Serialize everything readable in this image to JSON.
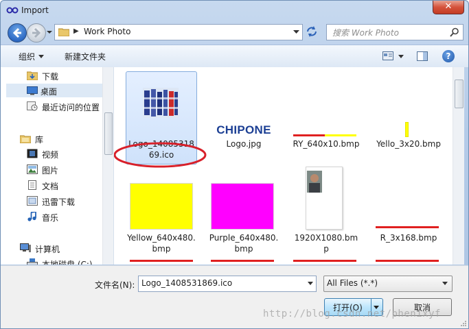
{
  "window": {
    "title": "Import",
    "close_label": "✕"
  },
  "nav": {
    "address_path": "Work Photo",
    "search_placeholder": "搜索 Work Photo"
  },
  "toolbar": {
    "organize_label": "组织",
    "new_folder_label": "新建文件夹",
    "help_label": "?"
  },
  "sidebar": {
    "items": [
      {
        "label": "下载",
        "icon": "download-folder-icon"
      },
      {
        "label": "桌面",
        "icon": "desktop-icon",
        "selected": true
      },
      {
        "label": "最近访问的位置",
        "icon": "recent-places-icon"
      },
      {
        "label": "库",
        "icon": "library-icon"
      },
      {
        "label": "视频",
        "icon": "video-library-icon"
      },
      {
        "label": "图片",
        "icon": "pictures-library-icon"
      },
      {
        "label": "文档",
        "icon": "documents-library-icon"
      },
      {
        "label": "迅雷下载",
        "icon": "thunder-download-icon"
      },
      {
        "label": "音乐",
        "icon": "music-library-icon"
      },
      {
        "label": "计算机",
        "icon": "computer-icon"
      },
      {
        "label": "本地磁盘 (C:)",
        "icon": "local-disk-icon"
      }
    ]
  },
  "files": {
    "items": [
      {
        "name_line1": "Logo_14085318",
        "name_line2": "69.ico",
        "selected": true
      },
      {
        "name_line1": "Logo.jpg",
        "name_line2": ""
      },
      {
        "name_line1": "RY_640x10.bmp",
        "name_line2": ""
      },
      {
        "name_line1": "Yello_3x20.bmp",
        "name_line2": ""
      },
      {
        "name_line1": "Yellow_640x480.",
        "name_line2": "bmp"
      },
      {
        "name_line1": "Purple_640x480.",
        "name_line2": "bmp"
      },
      {
        "name_line1": "1920X1080.bm",
        "name_line2": "p"
      },
      {
        "name_line1": "R_3x168.bmp",
        "name_line2": ""
      }
    ],
    "logo_text": "CHIPONE"
  },
  "bottom": {
    "filename_label": "文件名(N):",
    "filename_value": "Logo_1408531869.ico",
    "filetype_value": "All Files (*.*)",
    "open_label": "打开(O)",
    "cancel_label": "取消"
  },
  "watermark": "http://blog.csdn.net/phenixyf",
  "colors": {
    "yellow": "#ffff00",
    "purple": "#ff00ff",
    "red": "#e02020",
    "annotation_red": "#d8202a",
    "logo_blue": "#1c3f94"
  }
}
